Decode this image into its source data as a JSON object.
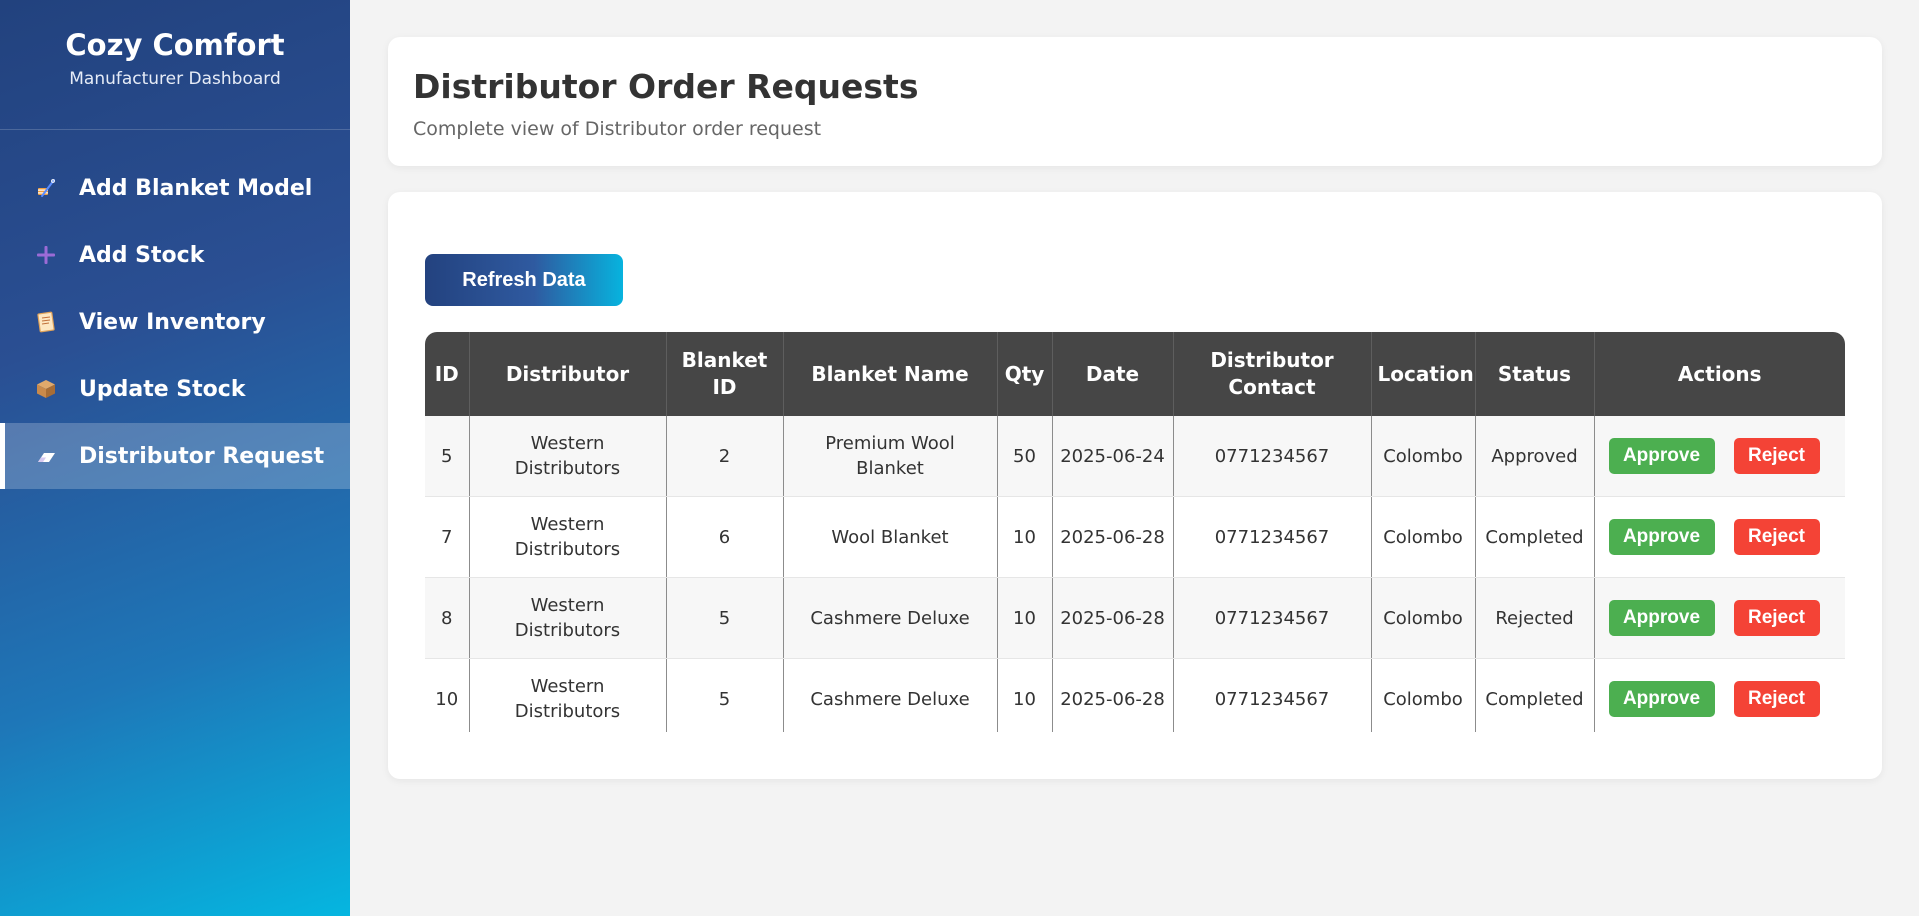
{
  "sidebar": {
    "brand_title": "Cozy Comfort",
    "brand_subtitle": "Manufacturer Dashboard",
    "items": [
      {
        "label": "Add Blanket Model",
        "icon": "sewing-needle-icon",
        "active": false
      },
      {
        "label": "Add Stock",
        "icon": "plus-icon",
        "active": false
      },
      {
        "label": "View Inventory",
        "icon": "clipboard-icon",
        "active": false
      },
      {
        "label": "Update Stock",
        "icon": "package-icon",
        "active": false
      },
      {
        "label": "Distributor Request",
        "icon": "eraser-icon",
        "active": true
      }
    ]
  },
  "header": {
    "title": "Distributor Order Requests",
    "subtitle": "Complete view of Distributor order request"
  },
  "toolbar": {
    "refresh_label": "Refresh Data"
  },
  "table": {
    "columns": [
      "ID",
      "Distributor",
      "Blanket ID",
      "Blanket Name",
      "Qty",
      "Date",
      "Distributor Contact",
      "Location",
      "Status",
      "Actions"
    ],
    "rows": [
      {
        "id": "5",
        "distributor": "Western Distributors",
        "blanket_id": "2",
        "blanket_name": "Premium Wool Blanket",
        "qty": "50",
        "date": "2025-06-24",
        "contact": "0771234567",
        "location": "Colombo",
        "status": "Approved"
      },
      {
        "id": "7",
        "distributor": "Western Distributors",
        "blanket_id": "6",
        "blanket_name": "Wool Blanket",
        "qty": "10",
        "date": "2025-06-28",
        "contact": "0771234567",
        "location": "Colombo",
        "status": "Completed"
      },
      {
        "id": "8",
        "distributor": "Western Distributors",
        "blanket_id": "5",
        "blanket_name": "Cashmere Deluxe",
        "qty": "10",
        "date": "2025-06-28",
        "contact": "0771234567",
        "location": "Colombo",
        "status": "Rejected"
      },
      {
        "id": "10",
        "distributor": "Western Distributors",
        "blanket_id": "5",
        "blanket_name": "Cashmere Deluxe",
        "qty": "10",
        "date": "2025-06-28",
        "contact": "0771234567",
        "location": "Colombo",
        "status": "Completed"
      }
    ],
    "approve_label": "Approve",
    "reject_label": "Reject"
  },
  "colors": {
    "sidebar_top": "#22427e",
    "sidebar_bottom": "#05b6e0",
    "table_header": "#464646",
    "approve": "#4caf50",
    "reject": "#f44336"
  }
}
